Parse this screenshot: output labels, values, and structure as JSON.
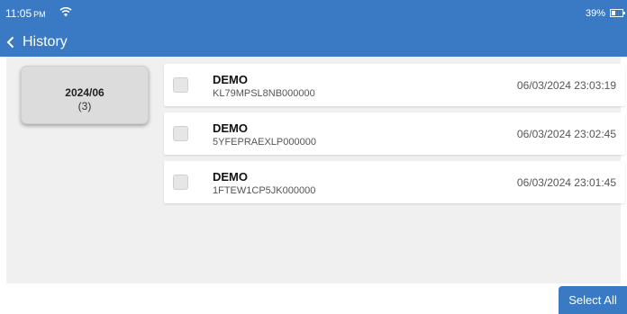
{
  "status_bar": {
    "time": "11:05",
    "ampm": "PM",
    "battery_text": "39%",
    "battery_level": 0.39,
    "wifi_icon": "wifi-icon",
    "battery_icon": "battery-icon"
  },
  "toolbar": {
    "back_icon": "chevron-left-icon",
    "title": "History"
  },
  "sidebar": {
    "month_label": "2024/06",
    "month_count": "(3)"
  },
  "records": [
    {
      "title": "DEMO",
      "vin": "KL79MPSL8NB000000",
      "date": "06/03/2024 23:03:19",
      "checked": false
    },
    {
      "title": "DEMO",
      "vin": "5YFEPRAEXLP000000",
      "date": "06/03/2024 23:02:45",
      "checked": false
    },
    {
      "title": "DEMO",
      "vin": "1FTEW1CP5JK000000",
      "date": "06/03/2024 23:01:45",
      "checked": false
    }
  ],
  "footer": {
    "select_all_label": "Select All"
  },
  "colors": {
    "primary": "#3a7ac4",
    "content_bg": "#f0f0f0",
    "card_bg": "#dcdcdc"
  }
}
